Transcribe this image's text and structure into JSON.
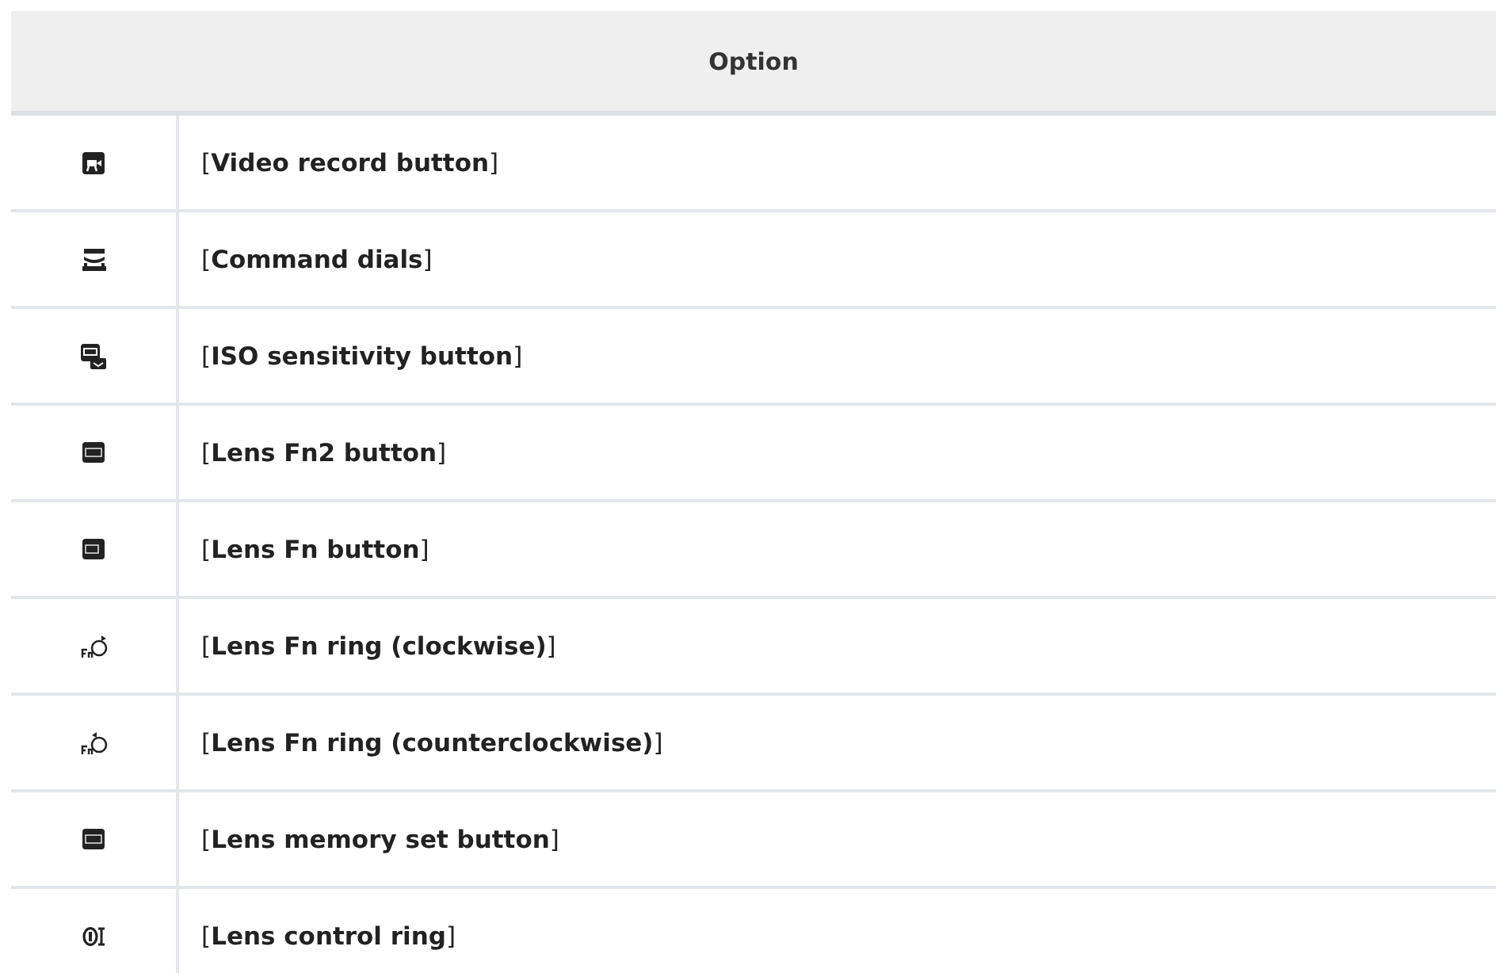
{
  "table": {
    "columns": [
      "Option"
    ],
    "rows": [
      {
        "kind": "video",
        "label": "[**Video record button**]"
      },
      {
        "kind": "dials",
        "label": "[**Command dials**]"
      },
      {
        "kind": "iso",
        "label": "[**ISO sensitivity button**]"
      },
      {
        "kind": "lfn2",
        "label": "[**Lens Fn2 button**]"
      },
      {
        "kind": "lfn",
        "label": "[**Lens Fn button**]"
      },
      {
        "kind": "ring-cw",
        "label": "[**Lens Fn ring (clockwise)**]"
      },
      {
        "kind": "ring-ccw",
        "label": "[**Lens Fn ring (counterclockwise)**]"
      },
      {
        "kind": "mset",
        "label": "[**Lens memory set button**]"
      },
      {
        "kind": "control-ring",
        "label": "[**Lens control ring**]"
      }
    ]
  }
}
